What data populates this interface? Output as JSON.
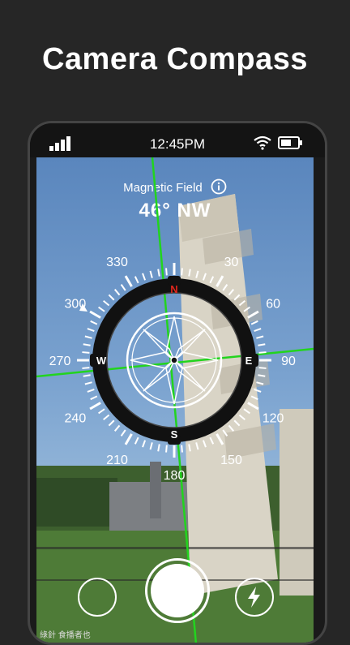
{
  "promo": {
    "title": "Camera Compass"
  },
  "status_bar": {
    "time": "12:45PM",
    "icons": [
      "signal-icon",
      "wifi-icon",
      "battery-icon"
    ]
  },
  "hud": {
    "label": "Magnetic Field",
    "info_icon": "info-icon",
    "heading": "46° NW"
  },
  "compass": {
    "degree_labels": [
      "30",
      "60",
      "90",
      "120",
      "150",
      "180",
      "210",
      "240",
      "270",
      "300",
      "330"
    ],
    "cardinals": [
      "N",
      "E",
      "S",
      "W"
    ],
    "accent_north": "#e1261c",
    "crosshair_color": "#22d41e"
  },
  "controls": {
    "gallery": "gallery-button",
    "shutter": "shutter-button",
    "flash": "flash-icon"
  },
  "watermark": "綠針 食播者也",
  "colors": {
    "background": "#262626",
    "crosshair": "#22d41e"
  }
}
